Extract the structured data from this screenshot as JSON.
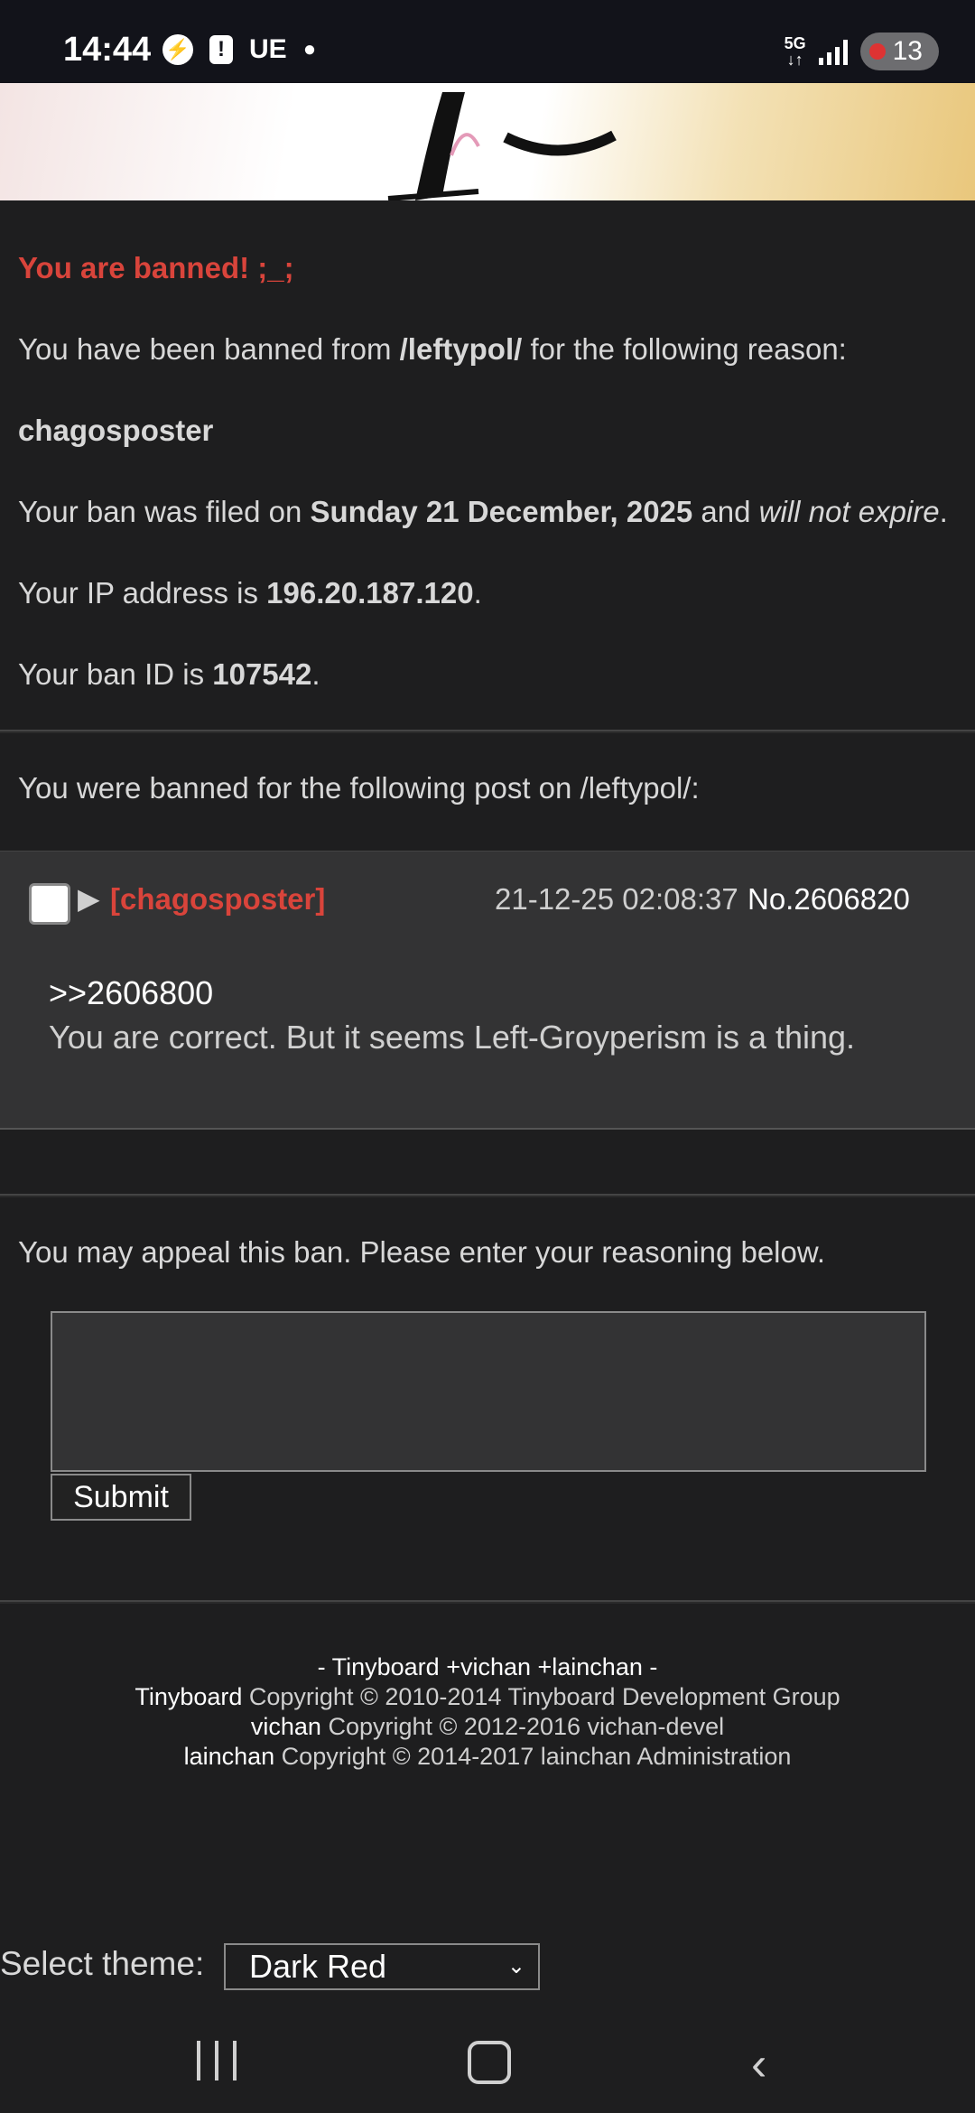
{
  "status_bar": {
    "time": "14:44",
    "carrier": "UE",
    "network": "5G",
    "battery": "13",
    "icons": [
      "messenger-icon",
      "alert-icon",
      "dot-icon",
      "signal-icon",
      "battery-icon"
    ]
  },
  "ban": {
    "title": "You are banned! ;_;",
    "banned_from_prefix": "You have been banned from ",
    "board": "/leftypol/",
    "banned_from_suffix": " for the following reason:",
    "reason": "chagosposter",
    "filed_prefix": "Your ban was filed on ",
    "filed_date": "Sunday 21 December, 2025",
    "filed_mid": " and ",
    "expiry": "will not expire",
    "filed_suffix": ".",
    "ip_prefix": "Your IP address is ",
    "ip": "196.20.187.120",
    "ip_suffix": ".",
    "id_prefix": "Your ban ID is ",
    "ban_id": "107542",
    "id_suffix": "."
  },
  "post_section": {
    "intro": "You were banned for the following post on /leftypol/:",
    "name": "[chagosposter]",
    "date": "21-12-25 02:08:37",
    "number": "No.2606820",
    "quote": ">>2606800",
    "body": "You are correct. But it seems Left-Groyperism is a thing."
  },
  "appeal": {
    "text": "You may appeal this ban. Please enter your reasoning below.",
    "textarea_value": "",
    "submit_label": "Submit"
  },
  "footer": {
    "line1": "- Tinyboard +vichan +lainchan -",
    "tinyboard_name": "Tinyboard",
    "tinyboard_copy": " Copyright © 2010-2014 Tinyboard Development Group",
    "vichan_name": "vichan",
    "vichan_copy": " Copyright © 2012-2016 vichan-devel",
    "lainchan_name": "lainchan",
    "lainchan_copy": " Copyright © 2014-2017 lainchan Administration"
  },
  "theme": {
    "label": "Select theme:",
    "selected": "Dark Red"
  },
  "colors": {
    "accent_red": "#d9443b",
    "background": "#1e1e1f",
    "post_background": "#333334"
  }
}
